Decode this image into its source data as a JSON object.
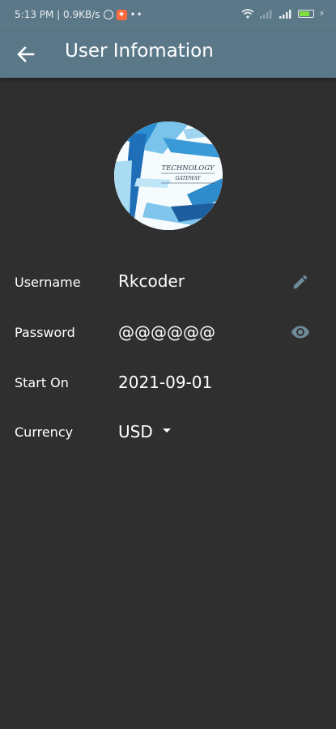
{
  "status_bar": {
    "left_text": "5:13 PM | 0.9KB/s",
    "notif_glyph": "★",
    "dots": "••",
    "bolt": "⚡"
  },
  "app_bar": {
    "title": "User Infomation",
    "back_icon": "arrow-left-icon"
  },
  "avatar": {
    "logo_text_line1": "TECHNOLOGY",
    "logo_text_line2": "GATEWAY"
  },
  "fields": {
    "username": {
      "label": "Username",
      "value": "Rkcoder",
      "action_icon": "edit-pencil-icon"
    },
    "password": {
      "label": "Password",
      "value": "@@@@@@",
      "action_icon": "eye-icon"
    },
    "start_on": {
      "label": "Start On",
      "value": "2021-09-01"
    },
    "currency": {
      "label": "Currency",
      "value": "USD",
      "dropdown_icon": "caret-down-icon"
    }
  },
  "colors": {
    "app_bar": "#5b7888",
    "background": "#2f2f2f",
    "icon_muted": "#6e8b9a"
  }
}
